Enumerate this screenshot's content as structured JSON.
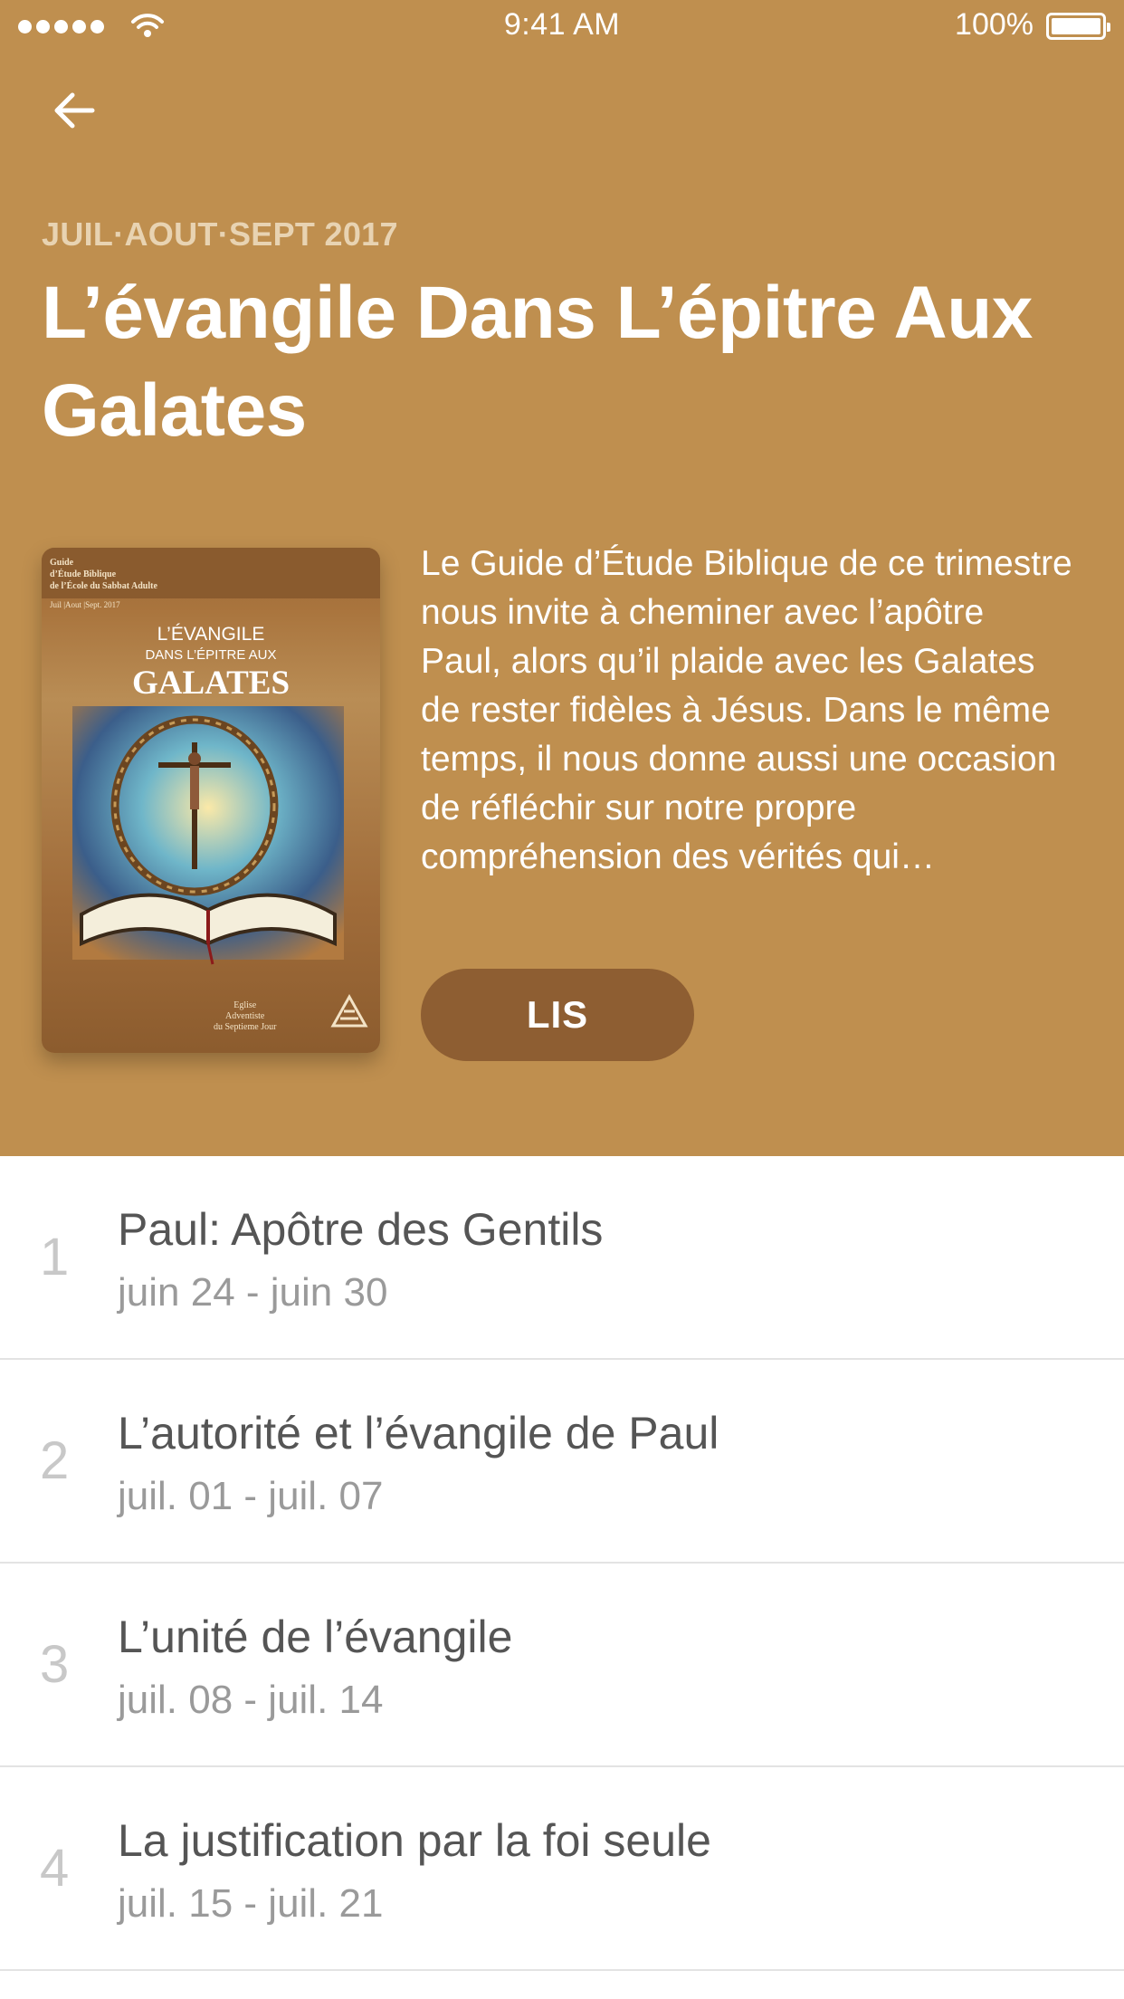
{
  "status_bar": {
    "time": "9:41 AM",
    "battery_percent": "100%",
    "signal_bars": 5
  },
  "header": {
    "background_color": "#bf8f4f",
    "back_icon": "arrow-left-icon",
    "quarter_label": "JUIL·AOUT·SEPT 2017",
    "title": "L’évangile Dans L’épitre Aux Galates",
    "description": "Le Guide d’Étude Biblique de ce trimestre nous invite à cheminer avec l’apôtre Paul, alors qu’il plaide avec les Galates de rester fidèles à Jésus. Dans le même temps, il nous donne aussi une occasion de réfléchir sur notre propre compréhension des vérités qui…",
    "read_button_label": "LIS",
    "read_button_color": "#8e5e32"
  },
  "cover": {
    "guide_line1": "Guide",
    "guide_line2": "d’Étude Biblique",
    "guide_line3": "de l’École du Sabbat Adulte",
    "period": "Juil |Aout |Sept. 2017",
    "title_line1": "L’ÉVANGILE",
    "title_line2": "DANS L’ÉPITRE AUX",
    "title_line3": "GALATES",
    "publisher_line1": "Eglise",
    "publisher_line2": "Adventiste",
    "publisher_line3": "du Septieme Jour"
  },
  "lessons": [
    {
      "number": "1",
      "title": "Paul: Apôtre des Gentils",
      "dates": "juin 24 - juin 30"
    },
    {
      "number": "2",
      "title": "L’autorité et l’évangile de Paul",
      "dates": "juil. 01 - juil. 07"
    },
    {
      "number": "3",
      "title": "L’unité de l’évangile",
      "dates": "juil. 08 - juil. 14"
    },
    {
      "number": "4",
      "title": "La justification par la foi seule",
      "dates": "juil. 15 - juil. 21"
    }
  ]
}
